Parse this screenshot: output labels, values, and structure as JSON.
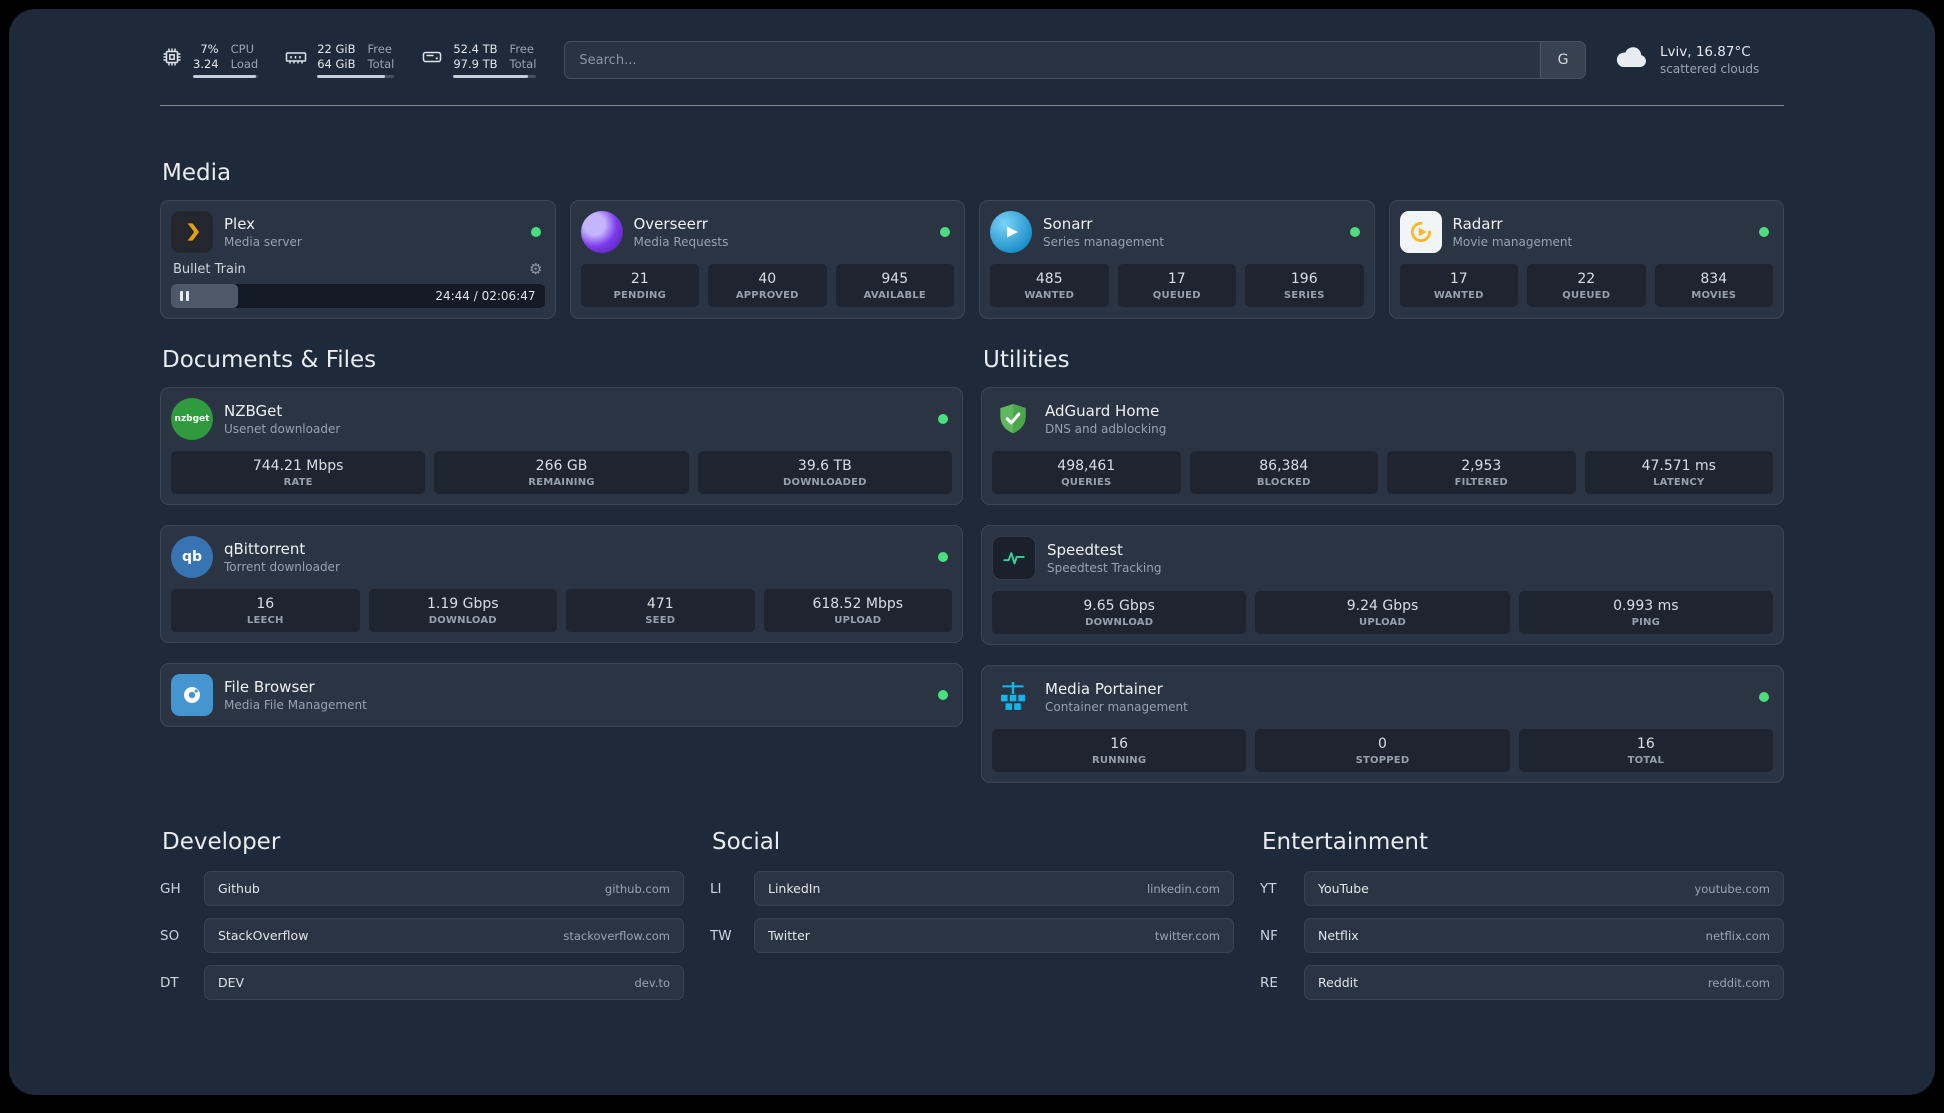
{
  "header": {
    "cpu": {
      "value_top": "7%",
      "value_bottom": "3.24",
      "label_top": "CPU",
      "label_bottom": "Load"
    },
    "memory": {
      "value_top": "22 GiB",
      "value_bottom": "64 GiB",
      "label_top": "Free",
      "label_bottom": "Total"
    },
    "disk": {
      "value_top": "52.4 TB",
      "value_bottom": "97.9 TB",
      "label_top": "Free",
      "label_bottom": "Total"
    },
    "search": {
      "placeholder": "Search...",
      "provider": "G"
    },
    "weather": {
      "location": "Lviv, 16.87°C",
      "condition": "scattered clouds"
    }
  },
  "sections": {
    "media": {
      "title": "Media"
    },
    "documents": {
      "title": "Documents & Files"
    },
    "utilities": {
      "title": "Utilities"
    }
  },
  "services": {
    "plex": {
      "name": "Plex",
      "subtitle": "Media server",
      "now_playing": "Bullet Train",
      "time": "24:44 / 02:06:47"
    },
    "overseerr": {
      "name": "Overseerr",
      "subtitle": "Media Requests",
      "stats": [
        {
          "value": "21",
          "label": "PENDING"
        },
        {
          "value": "40",
          "label": "APPROVED"
        },
        {
          "value": "945",
          "label": "AVAILABLE"
        }
      ]
    },
    "sonarr": {
      "name": "Sonarr",
      "subtitle": "Series management",
      "stats": [
        {
          "value": "485",
          "label": "WANTED"
        },
        {
          "value": "17",
          "label": "QUEUED"
        },
        {
          "value": "196",
          "label": "SERIES"
        }
      ]
    },
    "radarr": {
      "name": "Radarr",
      "subtitle": "Movie management",
      "stats": [
        {
          "value": "17",
          "label": "WANTED"
        },
        {
          "value": "22",
          "label": "QUEUED"
        },
        {
          "value": "834",
          "label": "MOVIES"
        }
      ]
    },
    "nzbget": {
      "name": "NZBGet",
      "subtitle": "Usenet downloader",
      "stats": [
        {
          "value": "744.21 Mbps",
          "label": "RATE"
        },
        {
          "value": "266 GB",
          "label": "REMAINING"
        },
        {
          "value": "39.6 TB",
          "label": "DOWNLOADED"
        }
      ]
    },
    "qbittorrent": {
      "name": "qBittorrent",
      "subtitle": "Torrent downloader",
      "stats": [
        {
          "value": "16",
          "label": "LEECH"
        },
        {
          "value": "1.19 Gbps",
          "label": "DOWNLOAD"
        },
        {
          "value": "471",
          "label": "SEED"
        },
        {
          "value": "618.52 Mbps",
          "label": "UPLOAD"
        }
      ]
    },
    "filebrowser": {
      "name": "File Browser",
      "subtitle": "Media File Management"
    },
    "adguard": {
      "name": "AdGuard Home",
      "subtitle": "DNS and adblocking",
      "stats": [
        {
          "value": "498,461",
          "label": "QUERIES"
        },
        {
          "value": "86,384",
          "label": "BLOCKED"
        },
        {
          "value": "2,953",
          "label": "FILTERED"
        },
        {
          "value": "47.571 ms",
          "label": "LATENCY"
        }
      ]
    },
    "speedtest": {
      "name": "Speedtest",
      "subtitle": "Speedtest Tracking",
      "stats": [
        {
          "value": "9.65 Gbps",
          "label": "DOWNLOAD"
        },
        {
          "value": "9.24 Gbps",
          "label": "UPLOAD"
        },
        {
          "value": "0.993 ms",
          "label": "PING"
        }
      ]
    },
    "portainer": {
      "name": "Media Portainer",
      "subtitle": "Container management",
      "stats": [
        {
          "value": "16",
          "label": "RUNNING"
        },
        {
          "value": "0",
          "label": "STOPPED"
        },
        {
          "value": "16",
          "label": "TOTAL"
        }
      ]
    }
  },
  "bookmarks": {
    "developer": {
      "title": "Developer",
      "items": [
        {
          "abbr": "GH",
          "name": "Github",
          "url": "github.com"
        },
        {
          "abbr": "SO",
          "name": "StackOverflow",
          "url": "stackoverflow.com"
        },
        {
          "abbr": "DT",
          "name": "DEV",
          "url": "dev.to"
        }
      ]
    },
    "social": {
      "title": "Social",
      "items": [
        {
          "abbr": "LI",
          "name": "LinkedIn",
          "url": "linkedin.com"
        },
        {
          "abbr": "TW",
          "name": "Twitter",
          "url": "twitter.com"
        }
      ]
    },
    "entertainment": {
      "title": "Entertainment",
      "items": [
        {
          "abbr": "YT",
          "name": "YouTube",
          "url": "youtube.com"
        },
        {
          "abbr": "NF",
          "name": "Netflix",
          "url": "netflix.com"
        },
        {
          "abbr": "RE",
          "name": "Reddit",
          "url": "reddit.com"
        }
      ]
    }
  },
  "icons": {
    "gear": "⚙",
    "nzbget_text": "nzbget",
    "qbittorrent_text": "qb"
  },
  "colors": {
    "status_online": "#4ade80",
    "plex_amber": "#e5a00d",
    "adguard_green": "#5eb95e",
    "speedtest_green": "#34d399",
    "portainer_blue": "#13b5ea"
  }
}
